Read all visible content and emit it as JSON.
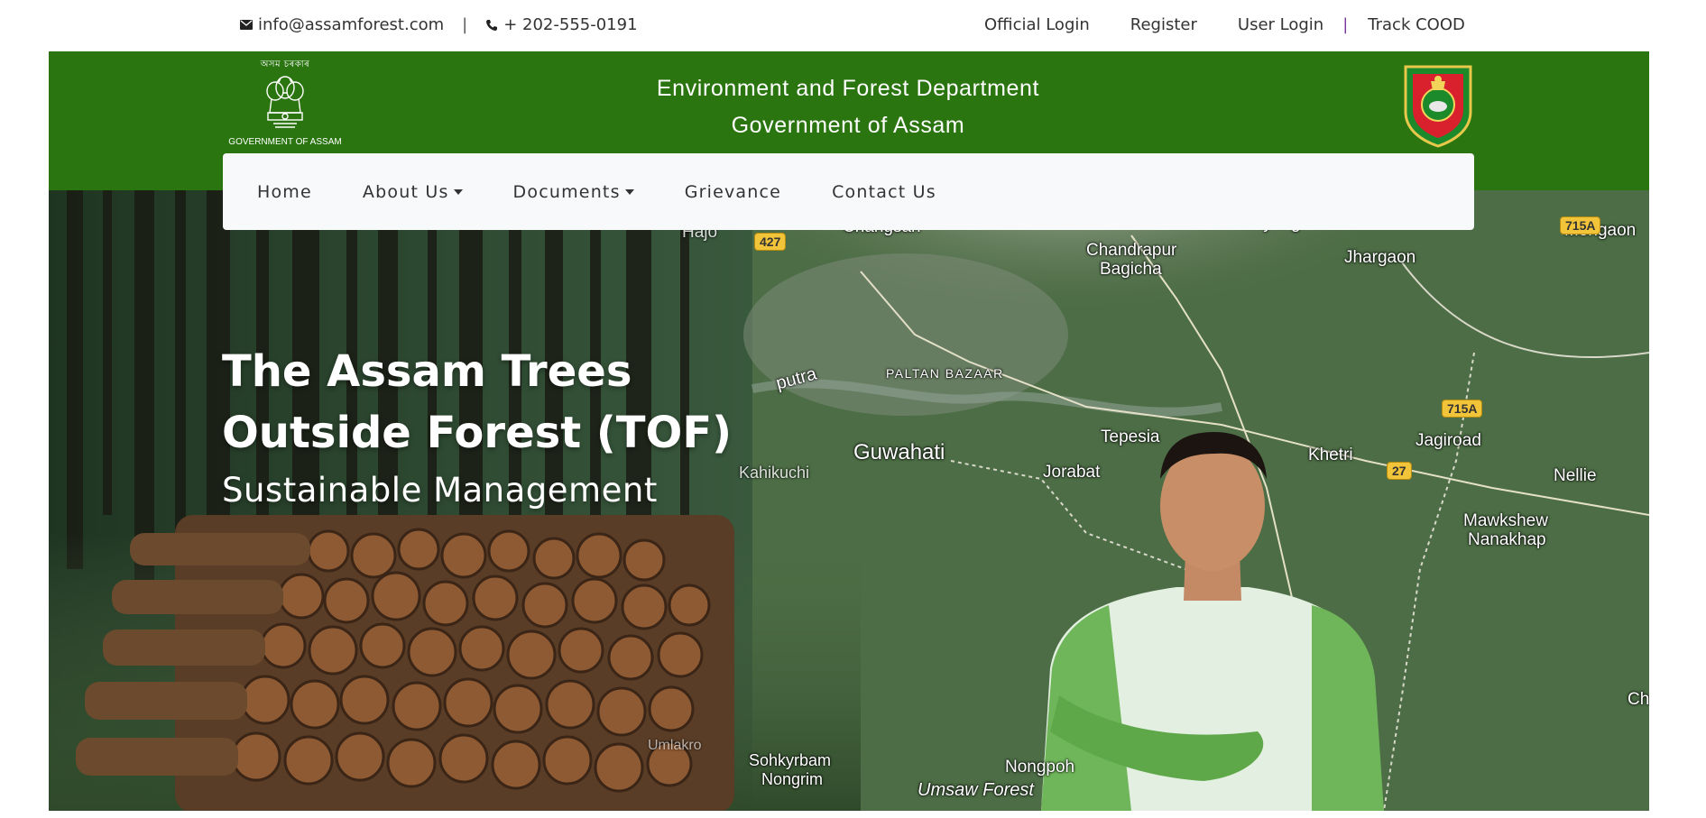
{
  "topbar": {
    "email": "info@assamforest.com",
    "separator": "|",
    "phone": "+ 202-555-0191",
    "links": [
      "Official Login",
      "Register",
      "User Login",
      "Track COOD"
    ],
    "pipe": "|"
  },
  "header": {
    "emblem_top_text": "অসম চৰকাৰ",
    "emblem_bottom_text": "GOVERNMENT OF ASSAM",
    "title_line1": "Environment and Forest Department",
    "title_line2": "Government of Assam",
    "brand_color": "#2a7510"
  },
  "nav": {
    "items": [
      {
        "label": "Home",
        "dropdown": false
      },
      {
        "label": "About Us",
        "dropdown": true
      },
      {
        "label": "Documents",
        "dropdown": true
      },
      {
        "label": "Grievance",
        "dropdown": false
      },
      {
        "label": "Contact Us",
        "dropdown": false
      }
    ]
  },
  "hero": {
    "title_line1": "The Assam Trees",
    "title_line2": "Outside Forest (TOF)",
    "subtitle": "Sustainable Management",
    "map_labels": {
      "changsari": "Changsari",
      "hajo": "Hajo",
      "mayang": "Mayang",
      "chandrapur": "Chandrapur",
      "bagicha": "Bagicha",
      "jhargaon": "Jhargaon",
      "morigaon": "Morigaon",
      "paltan": "PALTAN BAZAAR",
      "putra": "putra",
      "tepesia": "Tepesia",
      "guwahati": "Guwahati",
      "jorabat": "Jorabat",
      "khetri": "Khetri",
      "jagiroad": "Jagiroad",
      "nellie": "Nellie",
      "kahikuchi": "Kahikuchi",
      "mawkshew": "Mawkshew",
      "nanakhap": "Nanakhap",
      "nongpoh": "Nongpoh",
      "sohkyrbam": "Sohkyrbam",
      "nongrim": "Nongrim",
      "umsaw": "Umsaw Forest",
      "umlakro": "Umlakro",
      "ch": "Ch"
    },
    "road_shields": {
      "r27a": "27",
      "r427": "427",
      "r715a_top": "715A",
      "r715a_mid": "715A",
      "r27b": "27"
    }
  }
}
